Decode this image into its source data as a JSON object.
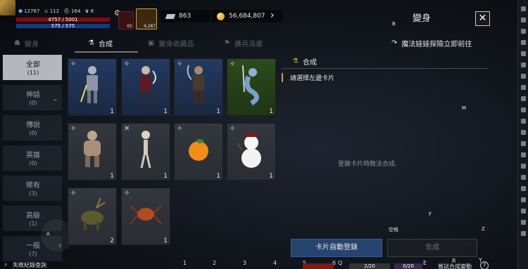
{
  "hud": {
    "combat_power": "12767",
    "stat_2": "112",
    "stat_3": "164",
    "stat_4": "8",
    "hp": "4757 / 5001",
    "mp": "575 / 575",
    "potion_count": "65",
    "scroll_count": "4,287",
    "crystals": "863",
    "gold": "56,684,807"
  },
  "window": {
    "title": "變身",
    "close": "✕"
  },
  "tabs": [
    {
      "label": "變身"
    },
    {
      "label": "合成"
    },
    {
      "label": "變身收藏品"
    },
    {
      "label": "傭兵派遣"
    }
  ],
  "explore_link": "魔法娃娃探險立即前往",
  "categories": [
    {
      "name": "全部",
      "count": "(11)"
    },
    {
      "name": "神話",
      "count": "(0)"
    },
    {
      "name": "傳說",
      "count": "(0)"
    },
    {
      "name": "英雄",
      "count": "(0)"
    },
    {
      "name": "稀有",
      "count": "(3)"
    },
    {
      "name": "高級",
      "count": "(1)"
    },
    {
      "name": "一般",
      "count": "(7)"
    }
  ],
  "cards": [
    {
      "count": "1"
    },
    {
      "count": "1"
    },
    {
      "count": "1"
    },
    {
      "count": "1"
    },
    {
      "count": "1"
    },
    {
      "count": "1"
    },
    {
      "count": "1"
    },
    {
      "count": "1"
    },
    {
      "count": "2"
    },
    {
      "count": "1"
    }
  ],
  "panel": {
    "header": "合成",
    "hint": "請選擇左邊卡片",
    "empty": "登錄卡片時無法合成.",
    "auto_button": "卡片自動登錄",
    "synth_button": "合成",
    "space_label": "空格"
  },
  "keys": [
    "B",
    "M",
    "F",
    "Z",
    "A",
    "D",
    "S",
    "1",
    "2",
    "3",
    "4",
    "5",
    "6",
    "Q",
    "E",
    "R",
    "Y"
  ],
  "bottom": {
    "failed_records": "失敗紀錄查詢",
    "slot_a": "2/20",
    "slot_b": "0/20",
    "try_synth": "嘗試合成變動"
  },
  "colors": {
    "accent_gold": "#c9a14a",
    "primary_button": "#26446f",
    "hp": "#7a0d12",
    "mp": "#143a87"
  }
}
